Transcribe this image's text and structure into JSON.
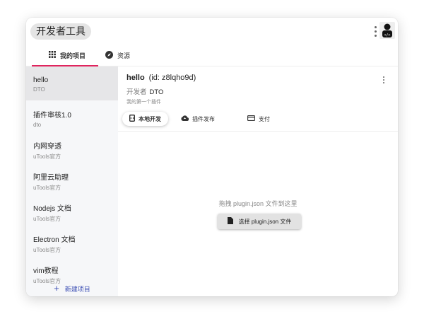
{
  "header": {
    "title": "开发者工具"
  },
  "tabs": [
    {
      "label": "我的项目",
      "icon": "grid-icon"
    },
    {
      "label": "资源",
      "icon": "compass-icon"
    }
  ],
  "projects": [
    {
      "name": "hello",
      "author": "DTO"
    },
    {
      "name": "插件审核1.0",
      "author": "dto"
    },
    {
      "name": "内网穿透",
      "author": "uTools官方"
    },
    {
      "name": "阿里云助理",
      "author": "uTools官方"
    },
    {
      "name": "Nodejs 文档",
      "author": "uTools官方"
    },
    {
      "name": "Electron 文档",
      "author": "uTools官方"
    },
    {
      "name": "vim教程",
      "author": "uTools官方"
    }
  ],
  "new_project": "新建项目",
  "detail": {
    "name": "hello",
    "id": "(id: z8lqho9d)",
    "dev_label": "开发者",
    "dev": "DTO",
    "desc": "我的第一个插件"
  },
  "subtabs": [
    "本地开发",
    "插件发布",
    "支付"
  ],
  "drop_text": "拖拽 plugin.json 文件到这里",
  "pick_button": "选择 plugin.json 文件",
  "accent": "#e0245e"
}
